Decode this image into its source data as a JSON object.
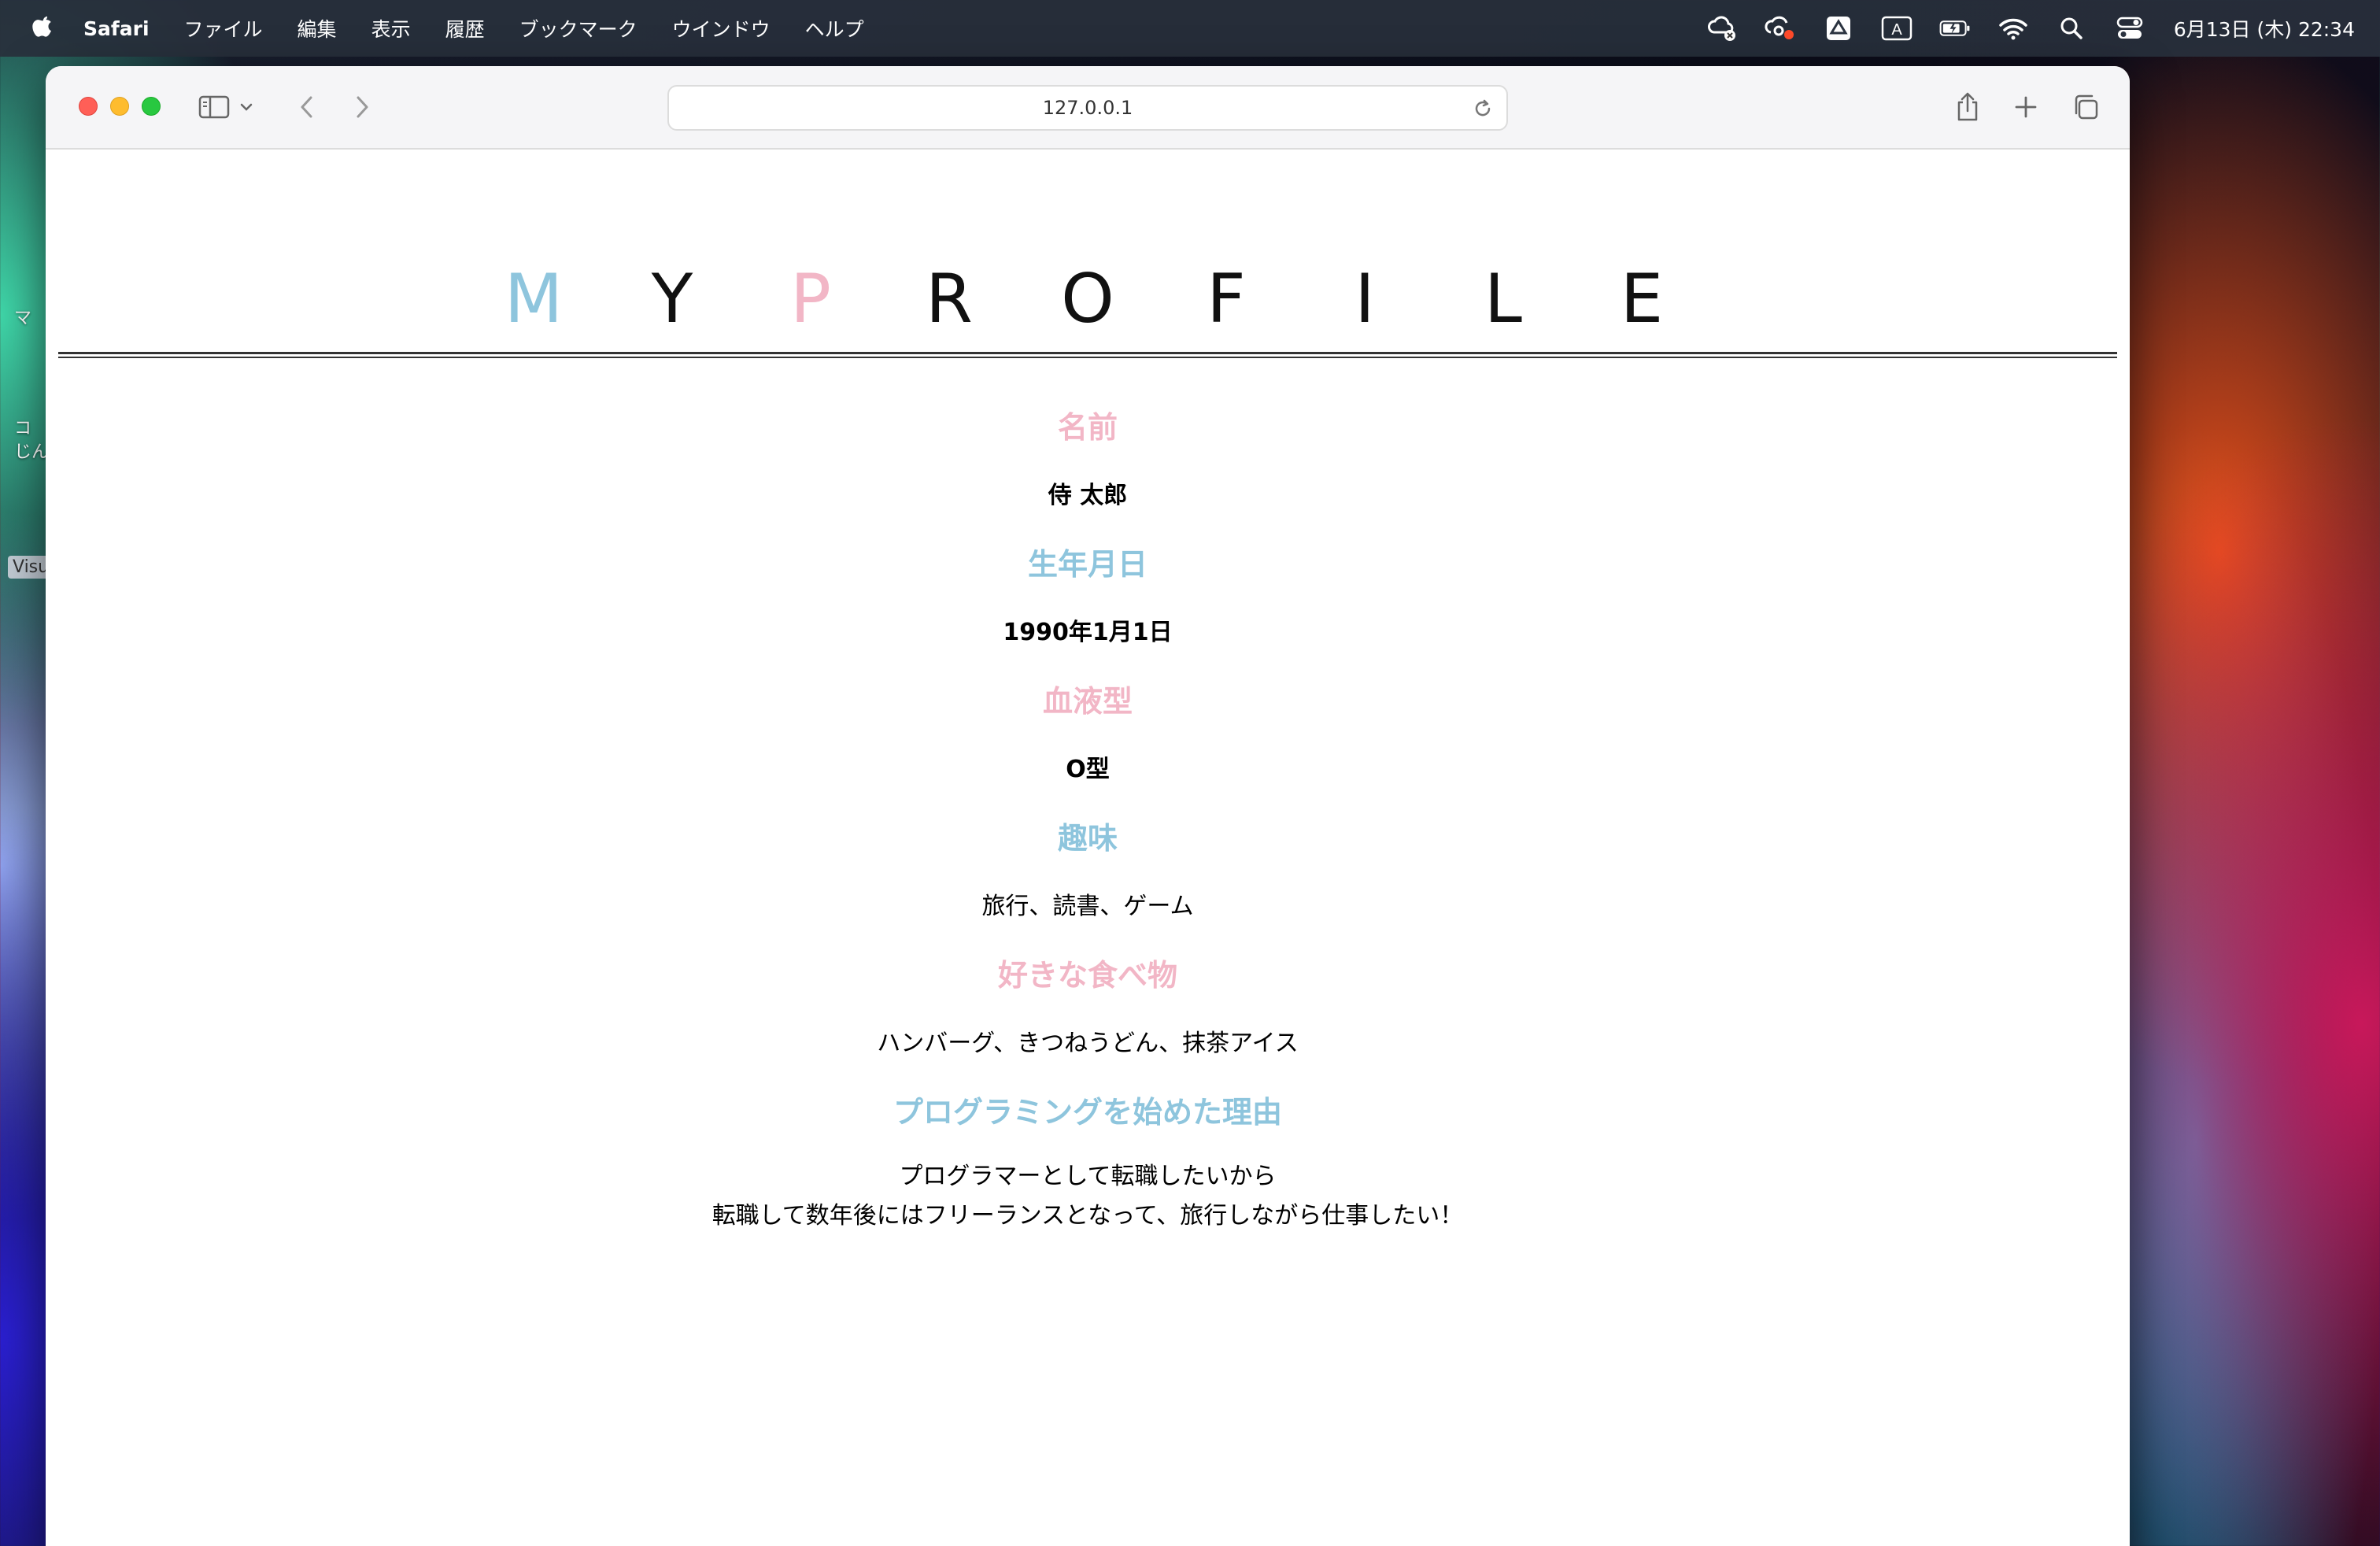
{
  "menubar": {
    "app_name": "Safari",
    "items": [
      "ファイル",
      "編集",
      "表示",
      "履歴",
      "ブックマーク",
      "ウインドウ",
      "ヘルプ"
    ],
    "status_icons": [
      "creative-cloud-icon",
      "cloud-sync-icon",
      "google-drive-icon",
      "input-method-icon",
      "battery-icon",
      "wifi-icon",
      "search-icon",
      "control-center-icon"
    ],
    "input_method_label": "A",
    "clock": "6月13日 (木)  22:34"
  },
  "desktop": {
    "fragments": [
      "マ",
      "コ",
      "じん"
    ],
    "tag": "Visu"
  },
  "browser": {
    "url": "127.0.0.1"
  },
  "page": {
    "title_letters": [
      "M",
      "Y",
      "P",
      "R",
      "O",
      "F",
      "I",
      "L",
      "E"
    ],
    "colors": {
      "pink": "#f2b6c6",
      "blue": "#8ec5dd"
    },
    "sections": [
      {
        "heading": "名前",
        "value": "侍 太郎"
      },
      {
        "heading": "生年月日",
        "value": "1990年1月1日"
      },
      {
        "heading": "血液型",
        "value": "O型"
      },
      {
        "heading": "趣味",
        "value": "旅行、読書、ゲーム"
      },
      {
        "heading": "好きな食べ物",
        "value": "ハンバーグ、きつねうどん、抹茶アイス"
      },
      {
        "heading": "プログラミングを始めた理由",
        "value_lines": [
          "プログラマーとして転職したいから",
          "転職して数年後にはフリーランスとなって、旅行しながら仕事したい！"
        ]
      }
    ]
  }
}
